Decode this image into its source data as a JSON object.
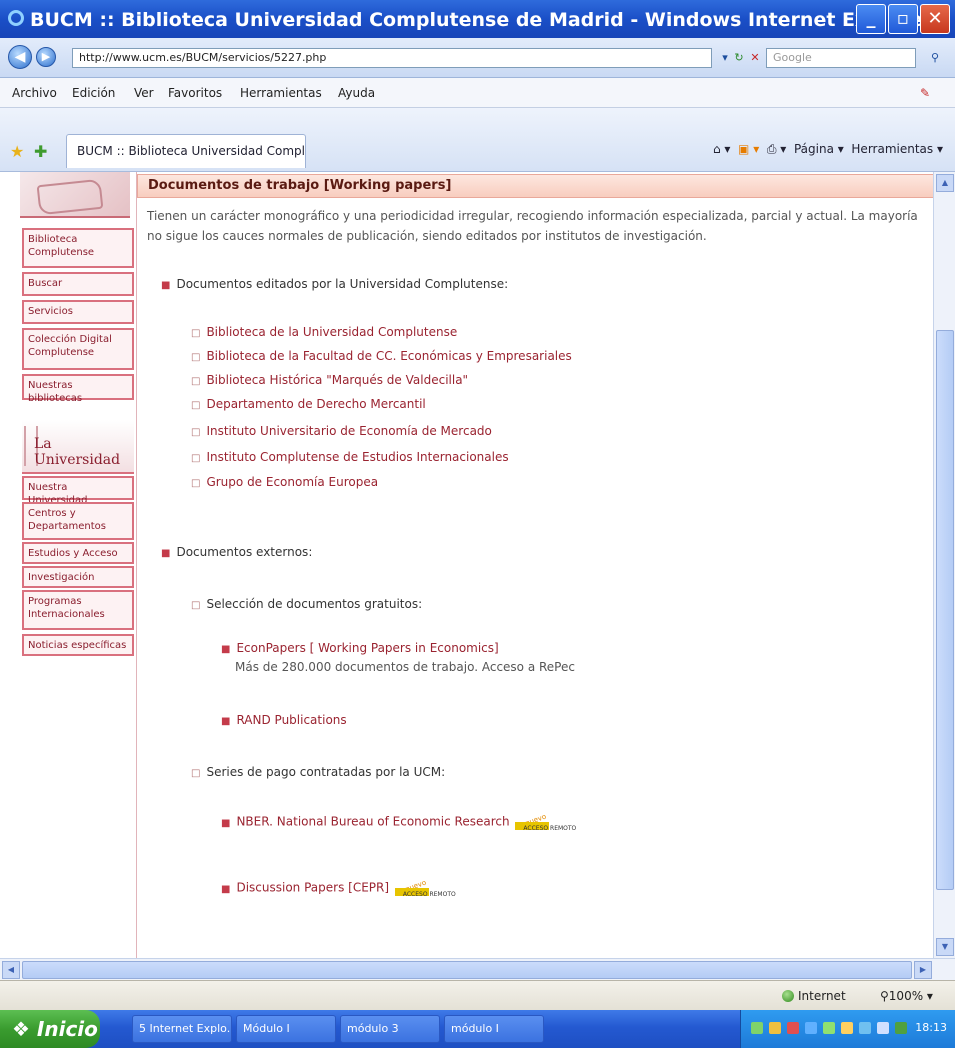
{
  "window": {
    "title": "BUCM :: Biblioteca Universidad Complutense de Madrid - Windows Internet Explorer"
  },
  "address_bar": {
    "url": "http://www.ucm.es/BUCM/servicios/5227.php",
    "search_placeholder": "Google"
  },
  "menu": {
    "items": [
      "Archivo",
      "Edición",
      "Ver",
      "Favoritos",
      "Herramientas",
      "Ayuda"
    ]
  },
  "tab": {
    "label": "BUCM :: Biblioteca Universidad Complutense ...",
    "toolbar_page": "Página",
    "toolbar_tools": "Herramientas"
  },
  "sidebar": {
    "items_top": [
      "Biblioteca Complutense",
      "Buscar",
      "Servicios",
      "Colección Digital Complutense",
      "Nuestras bibliotecas"
    ],
    "uni_label": "La Universidad",
    "items_bottom": [
      "Nuestra Universidad",
      "Centros y Departamentos",
      "Estudios y Acceso",
      "Investigación",
      "Programas Internacionales",
      "Noticias específicas"
    ]
  },
  "main": {
    "heading": "Documentos de trabajo [Working papers]",
    "intro": "Tienen un carácter monográfico y una periodicidad irregular, recogiendo información especializada, parcial y actual. La mayoría no sigue los cauces normales de publicación, siendo editados por institutos de investigación.",
    "section1": {
      "title": "Documentos editados por la Universidad Complutense:",
      "links": [
        "Biblioteca de la Universidad Complutense",
        "Biblioteca de la Facultad de CC. Económicas y Empresariales",
        "Biblioteca Histórica \"Marqués de Valdecilla\"",
        "Departamento de Derecho Mercantil",
        "Instituto Universitario de Economía de Mercado",
        "Instituto Complutense de Estudios Internacionales",
        "Grupo de Economía Europea"
      ]
    },
    "section2": {
      "title": "Documentos externos:",
      "free_title": "Selección de documentos gratuitos:",
      "econpapers": "EconPapers [ Working Papers in Economics]",
      "econpapers_desc": "Más de 280.000 documentos de trabajo. Acceso a RePec",
      "rand": "RAND Publications",
      "paid_title": "Series de pago contratadas por la UCM:",
      "nber": "NBER. National Bureau of Economic Research",
      "cepr": "Discussion Papers [CEPR]",
      "badge_new": "nuevo",
      "badge_text": "ACCESO REMOTO"
    }
  },
  "statusbar": {
    "zone": "Internet",
    "zoom": "100%"
  },
  "taskbar": {
    "start": "Inicio",
    "items": [
      "5 Internet Explo...",
      "Módulo I",
      "módulo 3",
      "módulo I"
    ],
    "clock": "18:13"
  }
}
